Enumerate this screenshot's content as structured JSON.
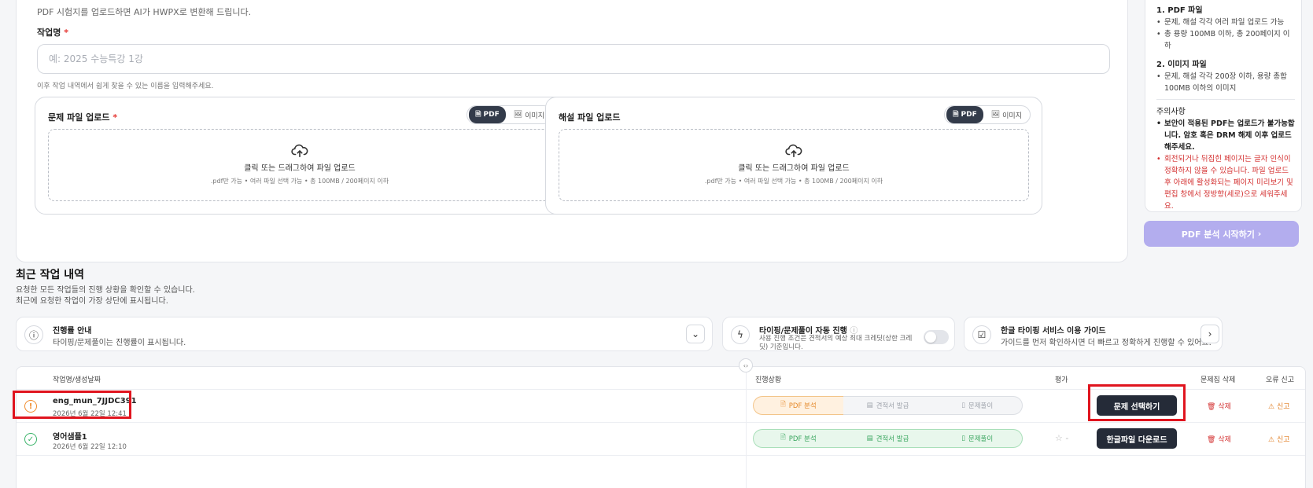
{
  "upload": {
    "intro": "PDF 시험지를 업로드하면 AI가 HWPX로 변환해 드립니다.",
    "name_label": "작업명",
    "required_mark": "*",
    "name_placeholder": "예: 2025 수능특강 1강",
    "name_hint": "이후 작업 내역에서 쉽게 찾을 수 있는 이름을 입력해주세요.",
    "panels": [
      {
        "title": "문제 파일 업로드",
        "required": "*",
        "pdf_label": "PDF",
        "img_label": "이미지",
        "drop_text": "클릭 또는 드래그하여 파일 업로드",
        "drop_sub": ".pdf만 가능 • 여러 파일 선택 가능 • 총 100MB / 200페이지 이하"
      },
      {
        "title": "해설 파일 업로드",
        "required": "",
        "pdf_label": "PDF",
        "img_label": "이미지",
        "drop_text": "클릭 또는 드래그하여 파일 업로드",
        "drop_sub": ".pdf만 가능 • 여러 파일 선택 가능 • 총 100MB / 200페이지 이하"
      }
    ]
  },
  "info": {
    "pdf_title": "1. PDF 파일",
    "pdf_items": [
      "문제, 해설 각각 여러 파일 업로드 가능",
      "총 용량 100MB 이하, 총 200페이지 이하"
    ],
    "img_title": "2. 이미지 파일",
    "img_items": [
      "문제, 해설 각각 200장 이하, 용량 총합 100MB 이하의 이미지"
    ],
    "caution_title": "주의사항",
    "caution_1": "보안이 적용된 PDF는 업로드가 불가능합니다. 암호 혹은 DRM 해제 이후 업로드 해주세요.",
    "caution_2": "회전되거나 뒤집힌 페이지는 글자 인식이 정확하지 않을 수 있습니다. 파일 업로드 후 아래에 활성화되는 페이지 미리보기 및 편집 창에서 정방향(세로)으로 세워주세요."
  },
  "start_button": "PDF 분석 시작하기",
  "history": {
    "title": "최근 작업 내역",
    "sub1": "요청한 모든 작업들의 진행 상황을 확인할 수 있습니다.",
    "sub2": "최근에 요청한 작업이 가장 상단에 표시됩니다.",
    "notices": [
      {
        "title": "진행률 안내",
        "desc": "타이핑/문제풀이는 진행률이 표시됩니다."
      },
      {
        "title": "타이핑/문제풀이 자동 진행",
        "desc": "사용 진행 조건은 견적서의 예상 최대 크레딧(상한 크레딧) 기준입니다."
      },
      {
        "title": "한글 타이핑 서비스 이용 가이드",
        "desc": "가이드를 먼저 확인하시면 더 빠르고 정확하게 진행할 수 있어요."
      }
    ],
    "columns": {
      "name": "작업명/생성날짜",
      "status": "진행상황",
      "rating": "평가",
      "delete": "문제집 삭제",
      "report": "오류 신고"
    },
    "rows": [
      {
        "name": "eng_mun_7JJDC391",
        "date": "2026년 6월 22일 12:41",
        "steps": [
          "PDF 분석",
          "견적서 발급",
          "문제풀이"
        ],
        "rating": "",
        "action": "문제 선택하기",
        "delete": "삭제",
        "report": "신고"
      },
      {
        "name": "영어샘플1",
        "date": "2026년 6월 22일 12:10",
        "steps": [
          "PDF 분석",
          "견적서 발급",
          "문제풀이"
        ],
        "rating": "-",
        "action": "한글파일 다운로드",
        "delete": "삭제",
        "report": "신고"
      }
    ]
  }
}
